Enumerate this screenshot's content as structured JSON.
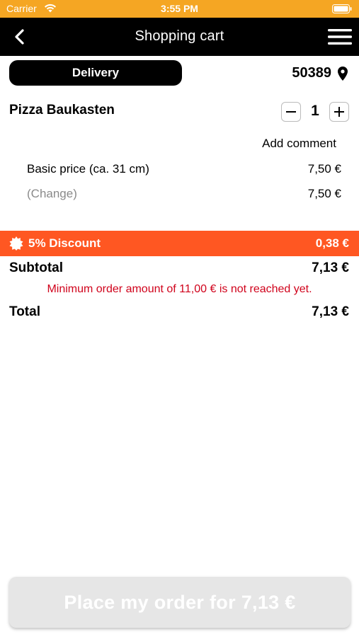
{
  "status_bar": {
    "carrier": "Carrier",
    "time": "3:55 PM",
    "background_color": "#f5a623"
  },
  "nav": {
    "title": "Shopping cart",
    "back_icon": "chevron-left-icon",
    "menu_icon": "hamburger-menu-icon"
  },
  "delivery": {
    "mode_label": "Delivery",
    "zip_code": "50389",
    "location_icon": "map-pin-icon"
  },
  "cart": {
    "items": [
      {
        "name": "Pizza Baukasten",
        "quantity": "1",
        "add_comment_label": "Add comment",
        "lines": [
          {
            "label": "Basic price (ca. 31 cm)",
            "price": "7,50 €"
          },
          {
            "label": "(Change)",
            "price": "7,50 €"
          }
        ]
      }
    ]
  },
  "discount": {
    "label": "5% Discount",
    "value": "0,38 €",
    "color": "#ff5722",
    "icon": "discount-badge-icon"
  },
  "summary": {
    "subtotal_label": "Subtotal",
    "subtotal_value": "7,13 €",
    "warning": "Minimum order amount of 11,00 € is not reached yet.",
    "warning_color": "#d0021b",
    "total_label": "Total",
    "total_value": "7,13 €"
  },
  "place_order": {
    "label": "Place my order for 7,13 €",
    "enabled": false
  }
}
